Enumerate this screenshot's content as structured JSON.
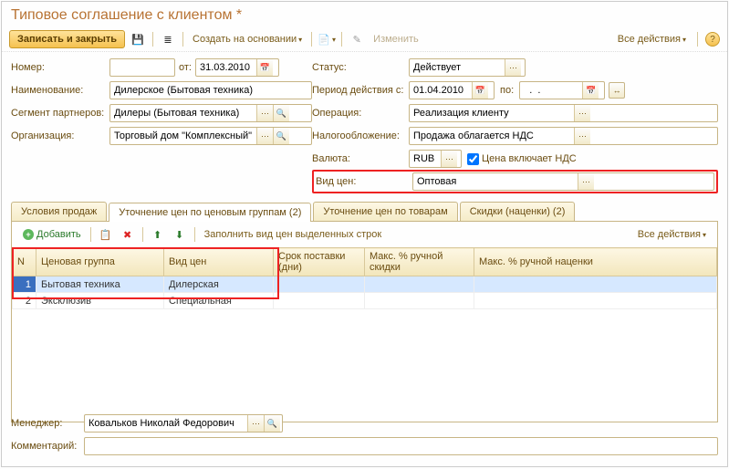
{
  "window": {
    "title": "Типовое соглашение с клиентом *"
  },
  "toolbar": {
    "save_close": "Записать и закрыть",
    "create_on": "Создать на основании",
    "edit": "Изменить",
    "all_actions": "Все действия"
  },
  "form": {
    "number_label": "Номер:",
    "number_value": "",
    "from_label": "от:",
    "from_value": "31.03.2010",
    "status_label": "Статус:",
    "status_value": "Действует",
    "name_label": "Наименование:",
    "name_value": "Дилерское (Бытовая техника)",
    "period_label": "Период действия с:",
    "period_from": "01.04.2010",
    "period_to_label": "по:",
    "period_to": "  .  .    ",
    "segment_label": "Сегмент партнеров:",
    "segment_value": "Дилеры (Бытовая техника)",
    "operation_label": "Операция:",
    "operation_value": "Реализация клиенту",
    "org_label": "Организация:",
    "org_value": "Торговый дом \"Комплексный\"",
    "tax_label": "Налогообложение:",
    "tax_value": "Продажа облагается НДС",
    "currency_label": "Валюта:",
    "currency_value": "RUB",
    "price_incl_vat": "Цена включает НДС",
    "price_type_label": "Вид цен:",
    "price_type_value": "Оптовая"
  },
  "tabs": {
    "t1": "Условия продаж",
    "t2": "Уточнение цен по ценовым группам (2)",
    "t3": "Уточнение цен по товарам",
    "t4": "Скидки (наценки) (2)"
  },
  "subtoolbar": {
    "add": "Добавить",
    "fill": "Заполнить вид цен выделенных строк",
    "all_actions": "Все действия"
  },
  "table": {
    "headers": {
      "n": "N",
      "group": "Ценовая группа",
      "price_type": "Вид цен",
      "delivery": "Срок поставки (дни)",
      "max_discount": "Макс. % ручной скидки",
      "max_markup": "Макс. % ручной наценки"
    },
    "rows": [
      {
        "n": "1",
        "group": "Бытовая техника",
        "price_type": "Дилерская"
      },
      {
        "n": "2",
        "group": "Эксклюзив",
        "price_type": "Специальная"
      }
    ]
  },
  "bottom": {
    "manager_label": "Менеджер:",
    "manager_value": "Ковальков Николай Федорович",
    "comment_label": "Комментарий:",
    "comment_value": ""
  }
}
